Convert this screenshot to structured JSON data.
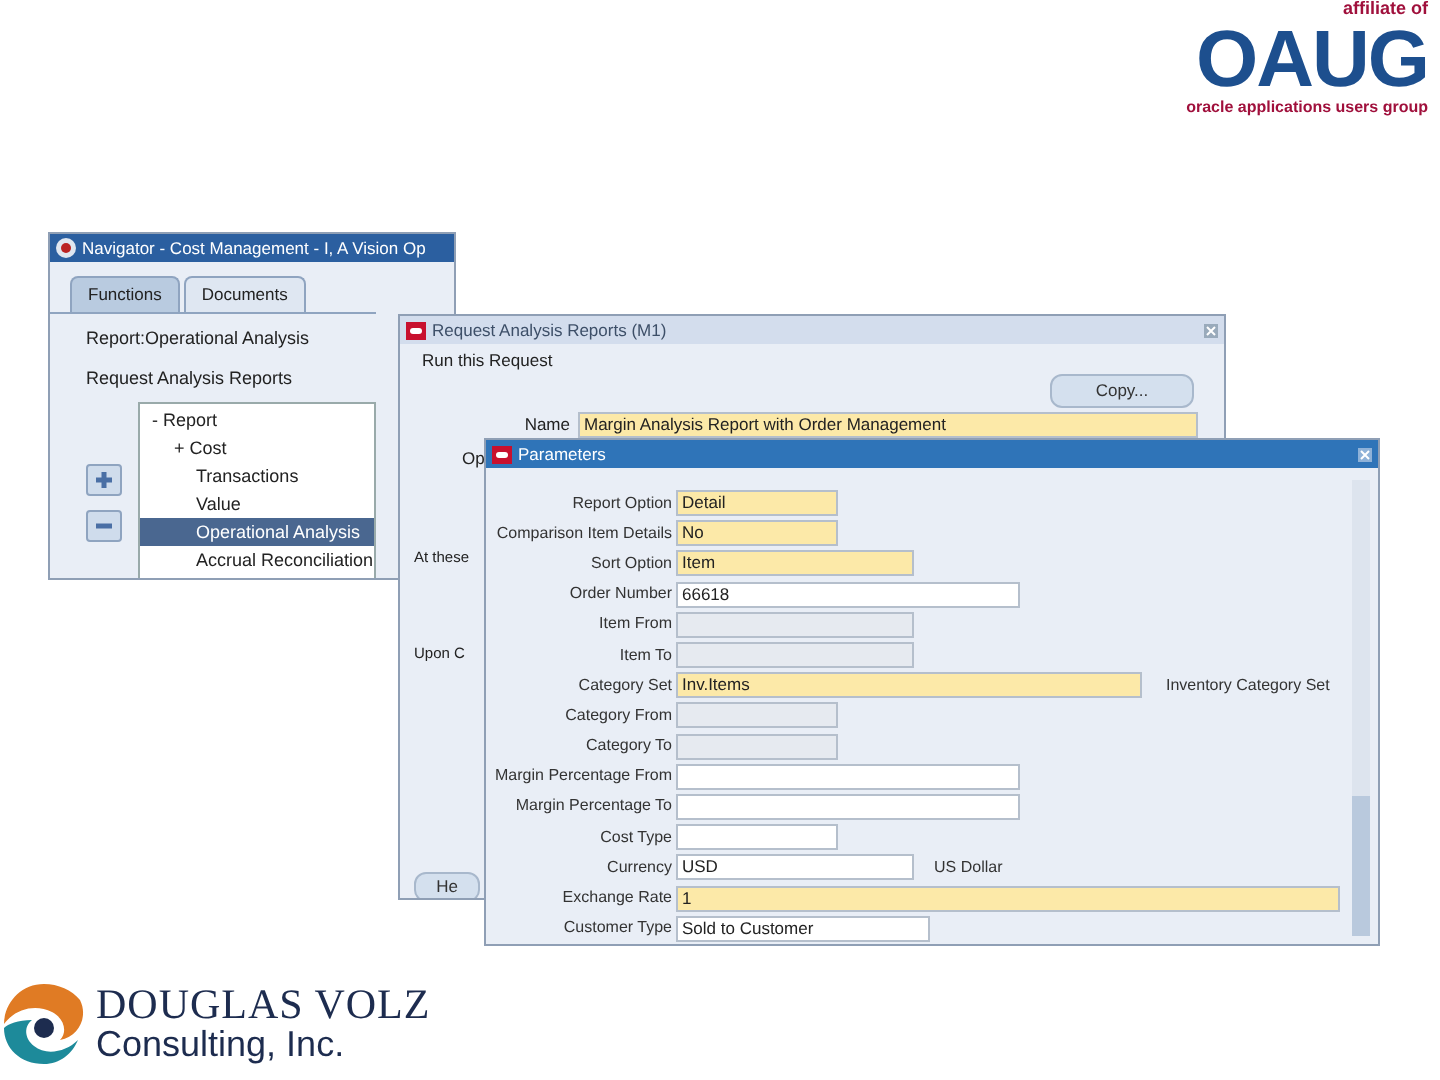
{
  "oaug_logo": {
    "tagline_top": "affiliate of",
    "wordmark": "OAUG",
    "tagline_bottom": "oracle applications users group"
  },
  "navigator": {
    "title": "Navigator - Cost Management - I, A Vision Op",
    "tabs": [
      {
        "label": "Functions",
        "selected": true
      },
      {
        "label": "Documents",
        "selected": false
      }
    ],
    "lines": [
      "Report:Operational Analysis",
      "Request Analysis Reports"
    ],
    "tree": [
      {
        "expander": "-",
        "label": "Report",
        "selected": false,
        "children": [
          {
            "expander": "+",
            "label": "Cost",
            "selected": false
          },
          {
            "label": "Transactions",
            "selected": false
          },
          {
            "label": "Value",
            "selected": false
          },
          {
            "label": "Operational Analysis",
            "selected": true
          },
          {
            "label": "Accrual Reconciliation",
            "selected": false
          }
        ]
      }
    ]
  },
  "request_window": {
    "title": "Request Analysis Reports (M1)",
    "section": "Run this Request",
    "copy_button": "Copy...",
    "fields": [
      {
        "label": "Name",
        "value": "Margin Analysis Report with Order Management",
        "kind": "required"
      }
    ],
    "cut_label": "Op",
    "cut_texts": [
      "At these",
      "Upon C"
    ],
    "help_button": "He"
  },
  "parameters": {
    "title": "Parameters",
    "rows": [
      {
        "label": "Report Option",
        "value": "Detail",
        "kind": "required"
      },
      {
        "label": "Comparison Item Details",
        "value": "No",
        "kind": "required"
      },
      {
        "label": "Sort Option",
        "value": "Item",
        "kind": "required"
      },
      {
        "label": "Order Number",
        "value": "66618",
        "kind": "optional"
      },
      {
        "label": "Item From",
        "kind": "disabled"
      },
      {
        "label": "Item To",
        "kind": "disabled"
      },
      {
        "label": "Category Set",
        "value": "Inv.Items",
        "kind": "required",
        "note": "Inventory Category Set"
      },
      {
        "label": "Category From",
        "kind": "disabled"
      },
      {
        "label": "Category To",
        "kind": "disabled"
      },
      {
        "label": "Margin Percentage From",
        "kind": "optional"
      },
      {
        "label": "Margin Percentage To",
        "kind": "optional"
      },
      {
        "label": "Cost Type",
        "kind": "optional"
      },
      {
        "label": "Currency",
        "value": "USD",
        "kind": "optional",
        "note": "US Dollar"
      },
      {
        "label": "Exchange Rate",
        "value": "1",
        "kind": "required"
      },
      {
        "label": "Customer Type",
        "value": "Sold to Customer",
        "kind": "optional"
      }
    ]
  },
  "company_logo": {
    "name": "DOUGLAS VOLZ",
    "subtitle": "Consulting, Inc."
  }
}
